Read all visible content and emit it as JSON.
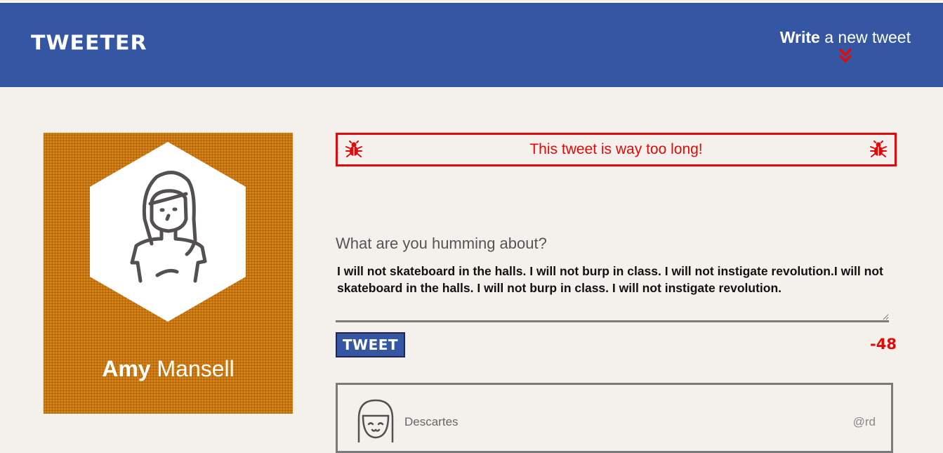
{
  "nav": {
    "brand": "TWEETER",
    "compose_bold": "Write",
    "compose_rest": " a new tweet",
    "chevron_icon": "double-chevron-down-icon"
  },
  "profile": {
    "first_name": "Amy",
    "last_name": " Mansell",
    "avatar_icon": "girl-avatar-icon"
  },
  "compose": {
    "error_message": "This tweet is way too long!",
    "error_icon": "bug-icon",
    "prompt": "What are you humming about?",
    "text": "I will not skateboard in the halls. I will not burp in class. I will not instigate revolution.I will not skateboard in the halls. I will not burp in class. I will not instigate revolution.",
    "submit_label": "TWEET",
    "counter": "-48"
  },
  "tweets": [
    {
      "name": "Descartes",
      "handle": "@rd",
      "avatar_icon": "smiling-avatar-icon"
    }
  ],
  "colors": {
    "nav": "#3557a3",
    "background": "#f4f1ec",
    "profile_bg": "#d9820f",
    "error": "#e10909"
  }
}
